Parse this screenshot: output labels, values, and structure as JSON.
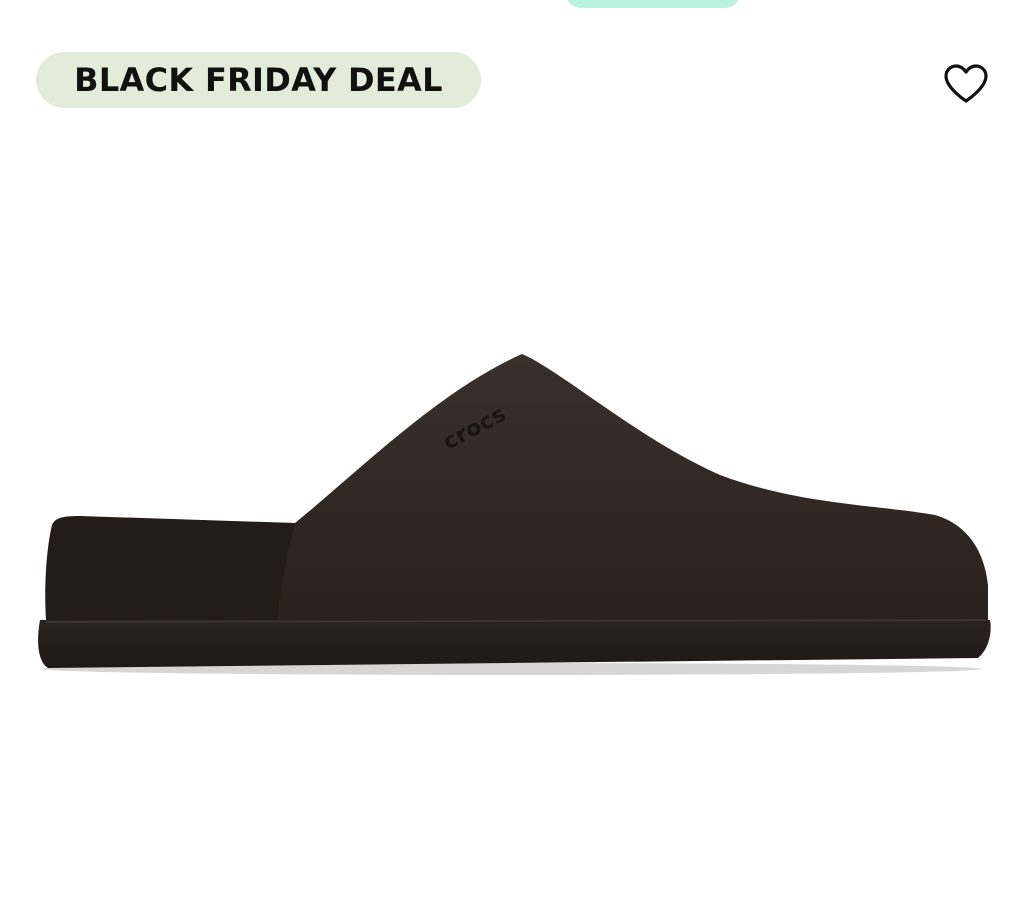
{
  "badge": {
    "label": "BLACK FRIDAY DEAL",
    "background": "#e3ecd9"
  },
  "top_tab": {
    "color": "#b9f3df"
  },
  "favorite": {
    "icon": "heart-outline-icon"
  },
  "product": {
    "image": "brown-clog-side-view",
    "brand_mark": "crocs",
    "color": "#2f2622"
  }
}
